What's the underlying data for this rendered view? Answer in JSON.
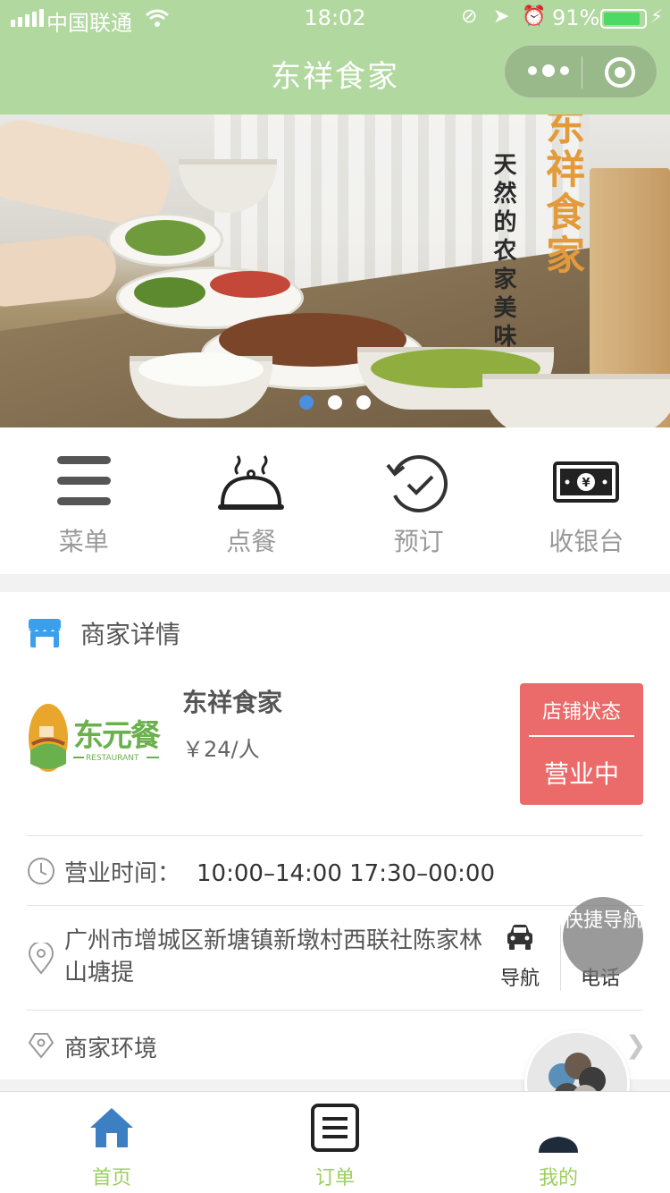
{
  "status_bar": {
    "carrier": "中国联通",
    "time": "18:02",
    "battery": "91%",
    "battery_level": 0.91
  },
  "nav": {
    "title": "东祥食家"
  },
  "banner": {
    "slogan": "天然的农家美味",
    "brand": "东祥食家",
    "slide_count": 3,
    "active_slide": 0
  },
  "quick_menu": [
    {
      "label": "菜单",
      "icon": "menu-icon"
    },
    {
      "label": "点餐",
      "icon": "cloche-icon"
    },
    {
      "label": "预订",
      "icon": "reserve-icon"
    },
    {
      "label": "收银台",
      "icon": "cashier-icon"
    }
  ],
  "merchant": {
    "section_title": "商家详情",
    "name": "东祥食家",
    "price": "￥24/人",
    "status_label": "店铺状态",
    "status_value": "营业中",
    "hours_label": "营业时间：",
    "hours_value": "10:00–14:00   17:30–00:00",
    "address": "广州市增城区新塘镇新墩村西联社陈家林山塘提",
    "nav_label": "导航",
    "phone_label": "电话",
    "environment_label": "商家环境"
  },
  "fab": {
    "quick_nav": "快捷导航"
  },
  "tabbar": [
    {
      "label": "首页",
      "icon": "home-icon",
      "active": true
    },
    {
      "label": "订单",
      "icon": "order-icon",
      "active": false
    },
    {
      "label": "我的",
      "icon": "user-icon",
      "active": false
    }
  ],
  "colors": {
    "nav_bg": "#b1d89f",
    "status_red": "#eb6b6b",
    "tab_green": "#9ccf5f",
    "pager_active": "#4a90e2"
  }
}
